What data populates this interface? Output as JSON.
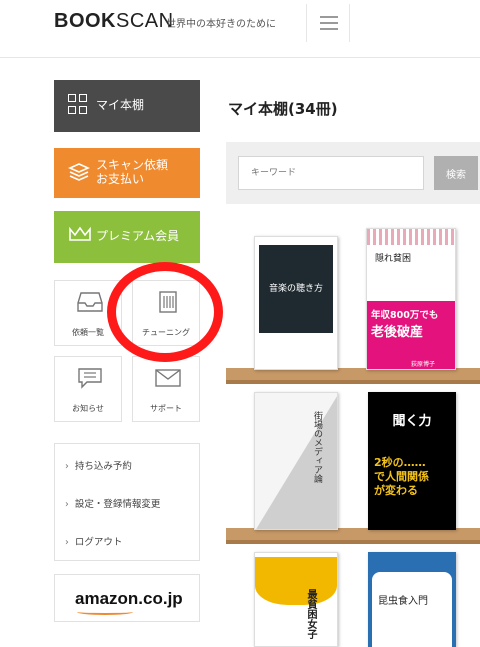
{
  "header": {
    "logo_bold": "BOOK",
    "logo_light": "SCAN",
    "tagline": "世界中の本好きのために",
    "menu_icon": "hamburger-icon"
  },
  "sidebar": {
    "my_shelf": {
      "label": "マイ本棚",
      "icon": "grid-icon",
      "color": "#4a4a4a"
    },
    "scan_payment": {
      "line1": "スキャン依頼",
      "line2": "お支払い",
      "icon": "layers-icon",
      "color": "#f08a2e"
    },
    "premium": {
      "label": "プレミアム会員",
      "icon": "crown-icon",
      "color": "#8cc03c"
    },
    "tiles": [
      {
        "label": "依頼一覧",
        "icon": "inbox-icon"
      },
      {
        "label": "チューニング",
        "icon": "tuning-icon"
      },
      {
        "label": "お知らせ",
        "icon": "notice-icon"
      },
      {
        "label": "サポート",
        "icon": "mail-icon"
      }
    ],
    "links": [
      {
        "label": "持ち込み予約"
      },
      {
        "label": "設定・登録情報変更"
      },
      {
        "label": "ログアウト"
      }
    ],
    "amazon_logo": "amazon.co.jp"
  },
  "main": {
    "title": "マイ本棚(34冊)",
    "search": {
      "placeholder": "キーワード",
      "button": "検索"
    },
    "books": [
      {
        "title": "音楽の聴き方"
      },
      {
        "title": "隠れ貧困",
        "headline1": "年収800万でも",
        "headline2": "老後破産",
        "author": "荻原博子"
      },
      {
        "title": "街場のメディア論"
      },
      {
        "title": "聞く力",
        "headline": "2秒の……で人間関係が変わる"
      },
      {
        "title": "最貧困女子"
      },
      {
        "title": "昆虫食入門"
      }
    ]
  },
  "annotation": {
    "color": "#ff1a1a"
  }
}
